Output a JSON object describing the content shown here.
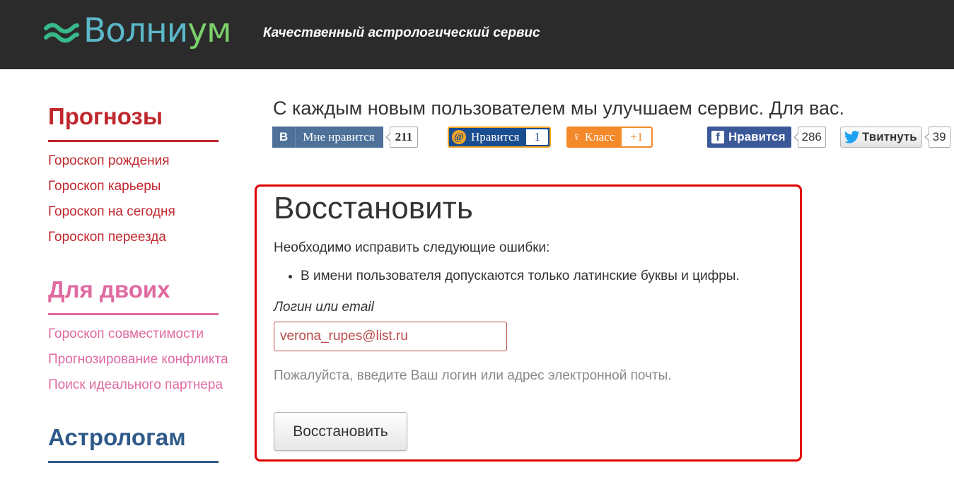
{
  "header": {
    "logo_text_blue": "Волни",
    "logo_text_green": "ум",
    "tagline": "Качественный астрологический сервис"
  },
  "sidebar": {
    "groups": [
      {
        "title": "Прогнозы",
        "items": [
          "Гороскоп рождения",
          "Гороскоп карьеры",
          "Гороскоп на сегодня",
          "Гороскоп переезда"
        ]
      },
      {
        "title": "Для двоих",
        "items": [
          "Гороскоп совместимости",
          "Прогнозирование конфликта",
          "Поиск идеального партнера"
        ]
      },
      {
        "title": "Астрологам"
      }
    ]
  },
  "slogan": "С каждым новым пользователем мы улучшаем сервис. Для вас.",
  "social": {
    "vk": {
      "logo": "В",
      "label": "Мне нравится",
      "count": "211"
    },
    "mail": {
      "label": "Нравится",
      "count": "1"
    },
    "ok": {
      "label": "Класс",
      "count": "+1"
    },
    "fb": {
      "label": "Нравится",
      "count": "286"
    },
    "tw": {
      "label": "Твитнуть",
      "count": "39"
    }
  },
  "form": {
    "title": "Восстановить",
    "error_intro": "Необходимо исправить следующие ошибки:",
    "errors": [
      "В имени пользователя допускаются только латинские буквы и цифры."
    ],
    "field_label": "Логин или email",
    "field_value": "verona_rupes@list.ru",
    "hint": "Пожалуйста, введите Ваш логин или адрес электронной почты.",
    "submit_label": "Восстановить"
  },
  "colors": {
    "header_bg": "#2b2b2b",
    "error_border": "#e00000",
    "sidebar_red": "#c0272d",
    "sidebar_pink": "#e06aa0",
    "sidebar_blue": "#2f5a8a"
  }
}
